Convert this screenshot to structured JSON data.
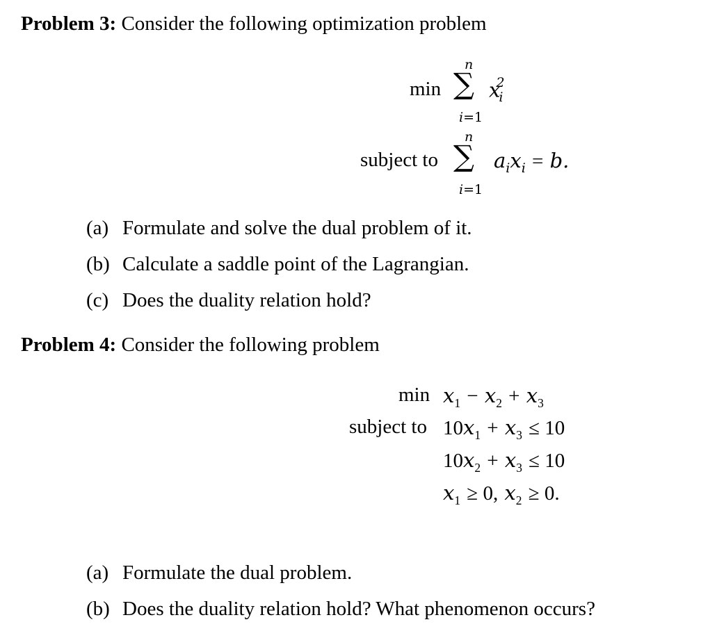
{
  "problem3": {
    "title": "Problem 3:",
    "intro": "Consider the following optimization problem",
    "objective": {
      "keyword": "min",
      "sum_upper": "n",
      "sum_lower_var": "i",
      "sum_lower_eq": "=1",
      "expression": "x_i^2"
    },
    "constraint": {
      "keyword": "subject to",
      "sum_upper": "n",
      "sum_lower_var": "i",
      "sum_lower_eq": "=1",
      "expression": "a_i x_i = b."
    },
    "parts": [
      {
        "label": "(a)",
        "text": "Formulate and solve the dual problem of it."
      },
      {
        "label": "(b)",
        "text": "Calculate a saddle point of the Lagrangian."
      },
      {
        "label": "(c)",
        "text": "Does the duality relation hold?"
      }
    ]
  },
  "problem4": {
    "title": "Problem 4:",
    "intro": "Consider the following problem",
    "objective": {
      "keyword": "min",
      "expression": "x1 − x2 + x3"
    },
    "constraints_keyword": "subject to",
    "constraints": [
      "10x1 + x3 ≤ 10",
      "10x2 + x3 ≤ 10",
      "x1 ≥ 0, x2 ≥ 0."
    ],
    "parts": [
      {
        "label": "(a)",
        "text": "Formulate the dual problem."
      },
      {
        "label": "(b)",
        "text": "Does the duality relation hold? What phenomenon occurs?"
      }
    ]
  }
}
